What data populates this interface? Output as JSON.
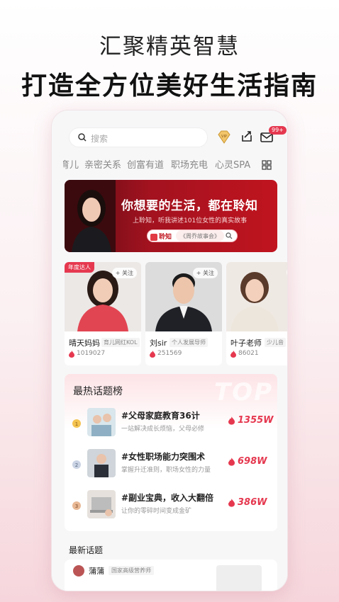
{
  "promo": {
    "subtitle": "汇聚精英智慧",
    "headline": "打造全方位美好生活指南"
  },
  "header": {
    "search_placeholder": "搜索",
    "mail_badge": "99+",
    "icons": [
      "search-icon",
      "vip-icon",
      "share-icon",
      "mail-icon",
      "grid-icon"
    ]
  },
  "categories": [
    "育儿",
    "亲密关系",
    "创富有道",
    "职场充电",
    "心灵SPA"
  ],
  "banner": {
    "title": "你想要的生活，都在聆知",
    "subtitle": "上聆知，听我讲述101位女性的真实故事",
    "logo": "聆知",
    "tag": "《周乔故事会》"
  },
  "experts": [
    {
      "name": "晴天妈妈",
      "tag": "育儿网红KOL",
      "count": "1019027",
      "follow": "+ 关注",
      "badge": "年度达人"
    },
    {
      "name": "刘sir",
      "tag": "个人发展导师",
      "count": "251569",
      "follow": "+ 关注",
      "badge": ""
    },
    {
      "name": "叶子老师",
      "tag": "少儿音",
      "count": "86021",
      "follow": "+",
      "badge": ""
    }
  ],
  "hot_topics": {
    "title": "最热话题榜",
    "bg_text": "TOP",
    "items": [
      {
        "rank": "1",
        "title": "#父母家庭教育36计",
        "subtitle": "一站解决成长烦恼，父母必修",
        "count": "1355W"
      },
      {
        "rank": "2",
        "title": "#女性职场能力突围术",
        "subtitle": "掌握升迁准则，职场女性的力量",
        "count": "698W"
      },
      {
        "rank": "3",
        "title": "#副业宝典，收入大翻倍",
        "subtitle": "让你的零碎时间变成金矿",
        "count": "386W"
      }
    ]
  },
  "latest": {
    "title": "最新话题",
    "author": "蒲蒲",
    "author_tag": "国家高级营养师"
  },
  "colors": {
    "accent": "#e5384f",
    "banner": "#a3121f"
  }
}
